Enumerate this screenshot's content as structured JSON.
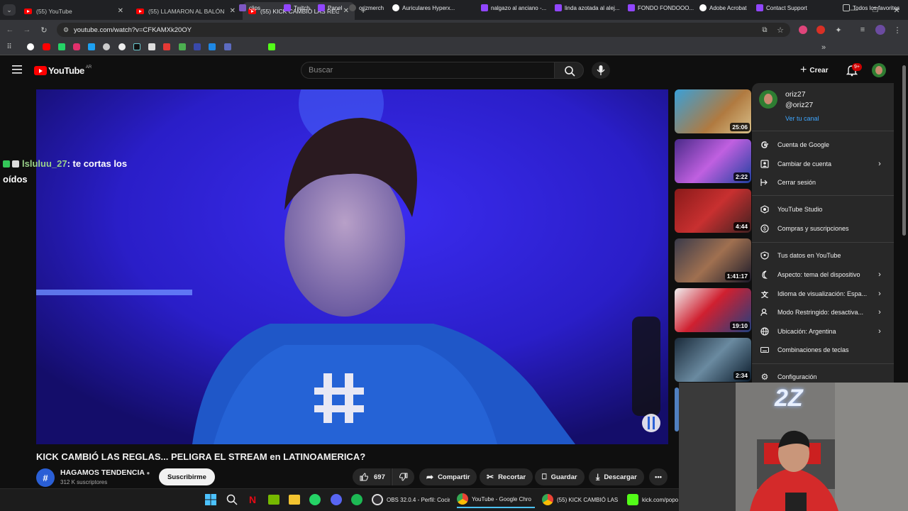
{
  "browser": {
    "tabs": [
      {
        "title": "(55) YouTube"
      },
      {
        "title": "(55) LLAMARON AL BALÓN DE"
      },
      {
        "title": "(55) KICK CAMBIÓ LAS REGLAS"
      }
    ],
    "url": "youtube.com/watch?v=CFKAMXk20OY",
    "bookmarks": [
      "clips",
      "Twitch",
      "Panel",
      "orizmerch",
      "Auriculares Hyperx...",
      "nalgazo al anciano -...",
      "linda azotada al alej...",
      "FONDO FONDOOO...",
      "Adobe Acrobat",
      "Contact Support"
    ],
    "all_bookmarks": "Todos los favoritos"
  },
  "youtube": {
    "logo": "YouTube",
    "region": "AR",
    "search_placeholder": "Buscar",
    "create_label": "Crear",
    "notif_badge": "9+"
  },
  "chat_overlay": {
    "user": "lsluluu_27",
    "message": ": te cortas los oídos"
  },
  "video": {
    "title": "KICK CAMBIÓ LAS REGLAS... PELIGRA EL STREAM en LATINOAMERICA?",
    "channel": "HAGAMOS TENDENCIA",
    "subscribers": "312 K suscriptores",
    "subscribe_label": "Suscribirme",
    "likes": "697",
    "share": "Compartir",
    "clip": "Recortar",
    "save": "Guardar",
    "download": "Descargar"
  },
  "sidebar": {
    "durations": [
      "25:06",
      "2:22",
      "4:44",
      "1:41:17",
      "19:10",
      "2:34"
    ]
  },
  "account_menu": {
    "name": "oriz27",
    "handle": "@oriz27",
    "view_channel": "Ver tu canal",
    "items": [
      {
        "label": "Cuenta de Google",
        "icon": "google-icon",
        "chevron": false
      },
      {
        "label": "Cambiar de cuenta",
        "icon": "switch-account-icon",
        "chevron": true
      },
      {
        "label": "Cerrar sesión",
        "icon": "sign-out-icon",
        "chevron": false
      },
      {
        "label": "YouTube Studio",
        "icon": "studio-icon",
        "chevron": false
      },
      {
        "label": "Compras y suscripciones",
        "icon": "dollar-icon",
        "chevron": false
      },
      {
        "label": "Tus datos en YouTube",
        "icon": "shield-person-icon",
        "chevron": false
      },
      {
        "label": "Aspecto: tema del dispositivo",
        "icon": "moon-icon",
        "chevron": true
      },
      {
        "label": "Idioma de visualización: Espa...",
        "icon": "translate-icon",
        "chevron": true
      },
      {
        "label": "Modo Restringido: desactiva...",
        "icon": "restricted-icon",
        "chevron": true
      },
      {
        "label": "Ubicación: Argentina",
        "icon": "globe-icon",
        "chevron": true
      },
      {
        "label": "Combinaciones de teclas",
        "icon": "keyboard-icon",
        "chevron": false
      },
      {
        "label": "Configuración",
        "icon": "gear-icon",
        "chevron": false
      }
    ]
  },
  "taskbar": {
    "items": [
      "OBS 32.0.4 - Perfil: Cocin",
      "YouTube - Google Chro",
      "(55) KICK CAMBIÓ LAS I",
      "kick.com/popo"
    ]
  },
  "webcam": {
    "logo_text": "2Z"
  },
  "colors": {
    "accent_blue": "#3ea6ff",
    "yt_red": "#ff0000",
    "menu_bg": "#282828"
  }
}
